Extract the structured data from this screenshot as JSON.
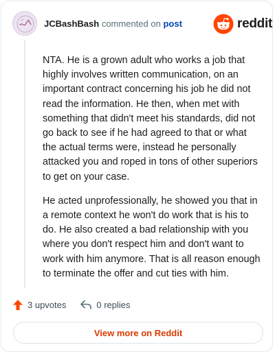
{
  "header": {
    "username": "JCBashBash",
    "action_text": "commented on",
    "post_link": "post",
    "logo_text": "reddit"
  },
  "comment": {
    "paragraphs": [
      "NTA. He is a grown adult who works a job that highly involves written communication, on an important contract concerning his job he did not read the information. He then, when met with something that didn't meet his standards, did not go back to see if he had agreed to that or what the actual terms were, instead he personally attacked you and roped in tons of other superiors to get on your case.",
      "He acted unprofessionally, he showed you that in a remote context he won't do work that is his to do. He also created a bad relationship with you where you don't respect him and don't want to work with him anymore. That is all reason enough to terminate the offer and cut ties with him."
    ]
  },
  "actions": {
    "upvotes": "3 upvotes",
    "replies": "0 replies"
  },
  "footer": {
    "view_more_label": "View more on Reddit"
  },
  "colors": {
    "brand": "#ff4500",
    "upvote": "#ff4500",
    "view_more_text": "#d93a00",
    "link": "#0045ac"
  },
  "icons": {
    "avatar": "user-avatar",
    "logo": "reddit-snoo-icon",
    "upvote": "upvote-arrow-icon",
    "reply": "reply-arrow-icon"
  }
}
